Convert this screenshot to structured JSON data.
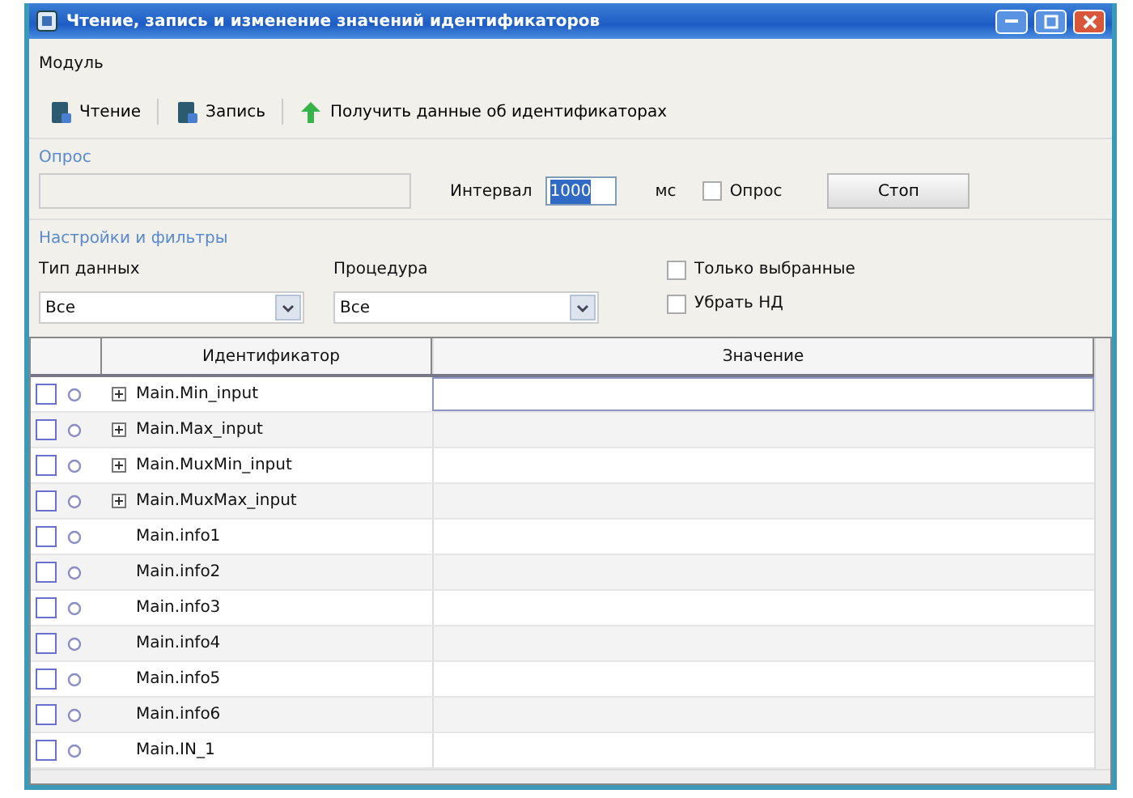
{
  "window": {
    "title": "Чтение, запись и изменение значений идентификаторов"
  },
  "menu": [
    "Модуль"
  ],
  "toolbar": [
    {
      "kind": "read",
      "label": "Чтение"
    },
    {
      "kind": "write",
      "label": "Запись"
    },
    {
      "kind": "fetch",
      "label": "Получить данные об идентификаторах"
    }
  ],
  "poll_group": {
    "title": "Опрос",
    "interval_label": "Интервал",
    "interval_value": "1000",
    "unit": "мс",
    "poll_checkbox": {
      "label": "Опрос",
      "checked": false
    },
    "stop_button": "Стоп"
  },
  "filters": {
    "title": "Настройки и фильтры",
    "data_type": {
      "label": "Тип данных",
      "value": "Все"
    },
    "procedure": {
      "label": "Процедура",
      "value": "Все"
    },
    "checkboxes": [
      {
        "label": "Только выбранные",
        "checked": false
      },
      {
        "label": "Убрать НД",
        "checked": false
      }
    ]
  },
  "table": {
    "columns": [
      "Идентификатор",
      "Значение"
    ],
    "rows": [
      {
        "name": "Main.Min_input",
        "expandable": true,
        "checked": false,
        "selected": false,
        "editing": true
      },
      {
        "name": "Main.Max_input",
        "expandable": true,
        "checked": false,
        "selected": false,
        "editing": false
      },
      {
        "name": "Main.MuxMin_input",
        "expandable": true,
        "checked": false,
        "selected": false,
        "editing": false
      },
      {
        "name": "Main.MuxMax_input",
        "expandable": true,
        "checked": false,
        "selected": false,
        "editing": false
      },
      {
        "name": "Main.info1",
        "expandable": false,
        "checked": false,
        "selected": false,
        "editing": false
      },
      {
        "name": "Main.info2",
        "expandable": false,
        "checked": false,
        "selected": false,
        "editing": false
      },
      {
        "name": "Main.info3",
        "expandable": false,
        "checked": false,
        "selected": false,
        "editing": false
      },
      {
        "name": "Main.info4",
        "expandable": false,
        "checked": false,
        "selected": false,
        "editing": false
      },
      {
        "name": "Main.info5",
        "expandable": false,
        "checked": false,
        "selected": false,
        "editing": false
      },
      {
        "name": "Main.info6",
        "expandable": false,
        "checked": false,
        "selected": false,
        "editing": false
      },
      {
        "name": "Main.IN_1",
        "expandable": false,
        "checked": false,
        "selected": false,
        "editing": false
      }
    ]
  }
}
